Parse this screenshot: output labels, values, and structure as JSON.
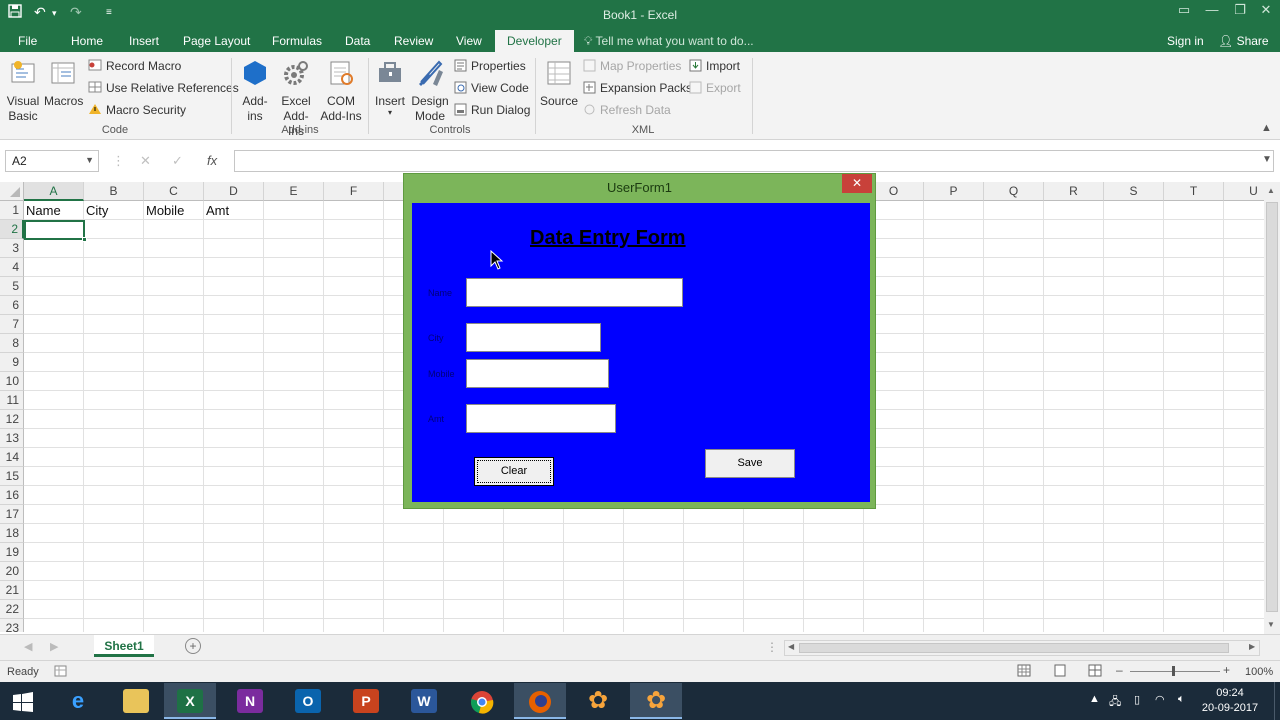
{
  "window": {
    "title": "Book1 - Excel"
  },
  "tabs": [
    "File",
    "Home",
    "Insert",
    "Page Layout",
    "Formulas",
    "Data",
    "Review",
    "View",
    "Developer"
  ],
  "active_tab": "Developer",
  "tell_me": "Tell me what you want to do...",
  "account": {
    "sign_in": "Sign in",
    "share": "Share"
  },
  "ribbon": {
    "code": {
      "label": "Code",
      "visual_basic": "Visual Basic",
      "macros": "Macros",
      "record_macro": "Record Macro",
      "use_relative": "Use Relative References",
      "macro_security": "Macro Security"
    },
    "addins": {
      "label": "Add-ins",
      "add_ins": "Add-ins",
      "excel_add_ins": "Excel Add-Ins",
      "com_add_ins": "COM Add-Ins"
    },
    "controls": {
      "label": "Controls",
      "insert": "Insert",
      "design_mode": "Design Mode",
      "properties": "Properties",
      "view_code": "View Code",
      "run_dialog": "Run Dialog"
    },
    "xml": {
      "label": "XML",
      "source": "Source",
      "map_properties": "Map Properties",
      "expansion_packs": "Expansion Packs",
      "refresh_data": "Refresh Data",
      "import": "Import",
      "export": "Export"
    }
  },
  "formula_bar": {
    "name_box": "A2",
    "fx": "fx",
    "value": ""
  },
  "grid": {
    "columns": [
      "A",
      "B",
      "C",
      "D",
      "E",
      "F",
      "G",
      "H",
      "I",
      "J",
      "K",
      "L",
      "M",
      "N",
      "O",
      "P",
      "Q",
      "R",
      "S",
      "T",
      "U"
    ],
    "rows": [
      "1",
      "2",
      "3",
      "4",
      "5",
      "6",
      "7",
      "8",
      "9",
      "10",
      "11",
      "12",
      "13",
      "14",
      "15",
      "16",
      "17",
      "18",
      "19",
      "20",
      "21",
      "22",
      "23"
    ],
    "cells": {
      "A1": "Name",
      "B1": "City",
      "C1": "Mobile",
      "D1": "Amt"
    },
    "active_cell": "A2"
  },
  "sheets": [
    "Sheet1"
  ],
  "status": {
    "text": "Ready",
    "zoom": "100%"
  },
  "userform": {
    "title": "UserForm1",
    "heading": "Data Entry Form",
    "labels": {
      "name": "Name",
      "city": "City",
      "mobile": "Mobile",
      "amt": "Amt"
    },
    "buttons": {
      "clear": "Clear",
      "save": "Save"
    }
  },
  "taskbar": {
    "apps": [
      "windows-start",
      "internet-explorer",
      "file-explorer",
      "excel",
      "onenote",
      "outlook",
      "powerpoint",
      "word",
      "chrome",
      "firefox",
      "app-flower-1",
      "app-flower-2"
    ],
    "active": "excel",
    "clock": {
      "time": "09:24",
      "date": "20-09-2017"
    }
  },
  "colors": {
    "excel_green": "#217346",
    "form_frame": "#7cb55a",
    "form_body": "#0000ff",
    "close_red": "#c8413a"
  }
}
